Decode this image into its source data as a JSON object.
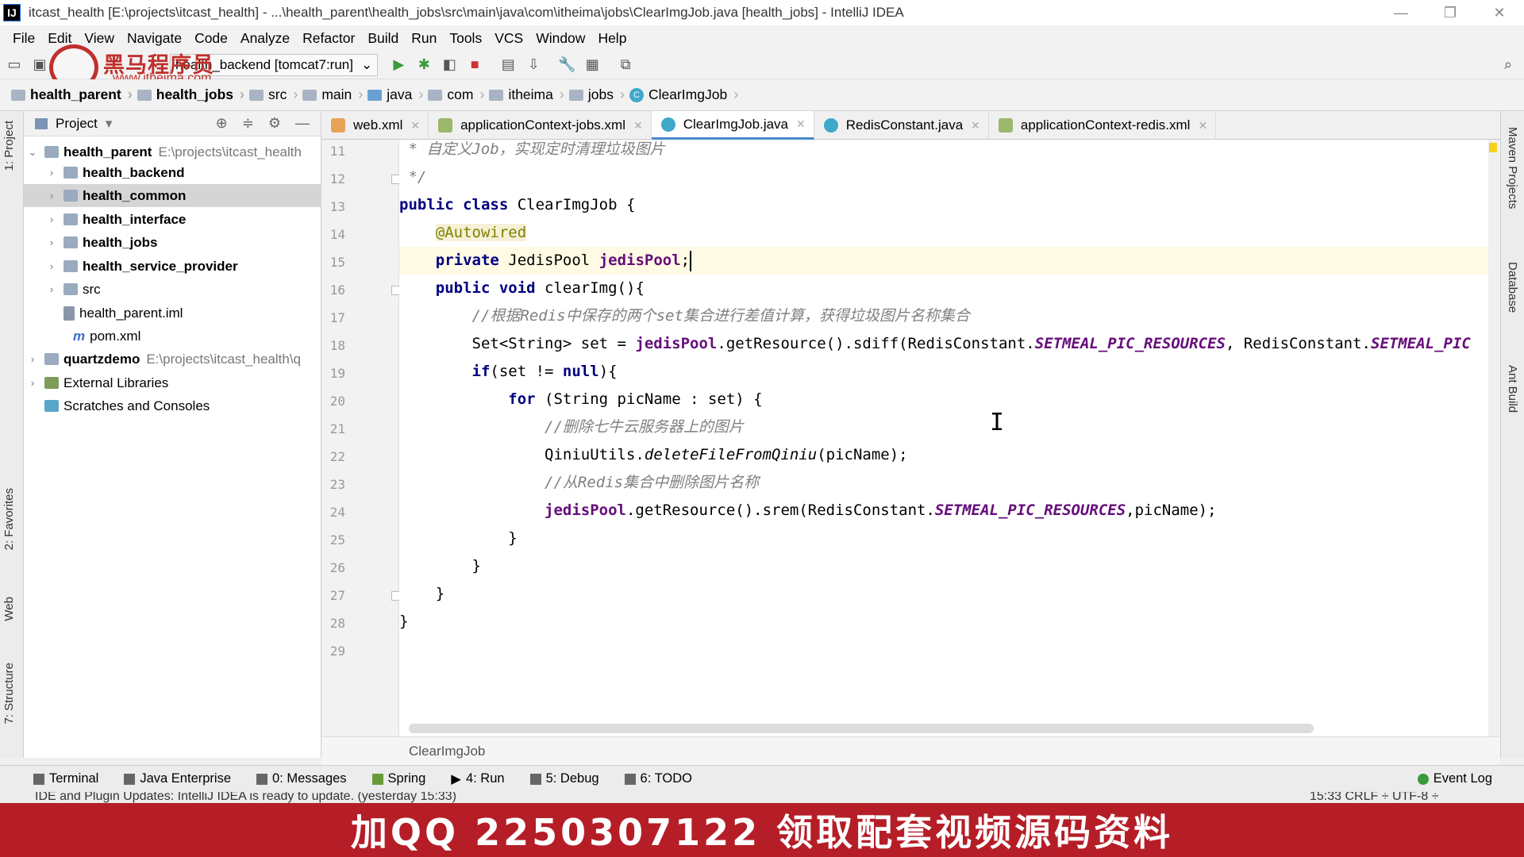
{
  "window": {
    "title": "itcast_health [E:\\projects\\itcast_health] - ...\\health_parent\\health_jobs\\src\\main\\java\\com\\itheima\\jobs\\ClearImgJob.java [health_jobs] - IntelliJ IDEA",
    "app_icon": "IJ",
    "minimize": "—",
    "restore": "❐",
    "close": "✕"
  },
  "menu": [
    "File",
    "Edit",
    "View",
    "Navigate",
    "Code",
    "Analyze",
    "Refactor",
    "Build",
    "Run",
    "Tools",
    "VCS",
    "Window",
    "Help"
  ],
  "toolbar": {
    "run_config": "health_backend [tomcat7:run]",
    "dropdown_glyph": "⌄"
  },
  "watermark": {
    "text": "黑马程序员",
    "url": "www.itheima.com"
  },
  "breadcrumb": [
    "health_parent",
    "health_jobs",
    "src",
    "main",
    "java",
    "com",
    "itheima",
    "jobs",
    "ClearImgJob"
  ],
  "left_strip": {
    "project": "1: Project",
    "favorites": "2: Favorites",
    "web": "Web",
    "structure": "7: Structure"
  },
  "right_strip": {
    "maven": "Maven Projects",
    "database": "Database",
    "ant": "Ant Build"
  },
  "project_panel": {
    "title": "Project",
    "tree": [
      {
        "label": "health_parent",
        "path": "E:\\projects\\itcast_health",
        "bold": true
      },
      {
        "label": "health_backend",
        "bold": true
      },
      {
        "label": "health_common",
        "bold": true
      },
      {
        "label": "health_interface",
        "bold": true
      },
      {
        "label": "health_jobs",
        "bold": true
      },
      {
        "label": "health_service_provider",
        "bold": true
      },
      {
        "label": "src"
      },
      {
        "label": "health_parent.iml"
      },
      {
        "label": "pom.xml"
      },
      {
        "label": "quartzdemo",
        "path": "E:\\projects\\itcast_health\\q",
        "bold": true
      },
      {
        "label": "External Libraries"
      },
      {
        "label": "Scratches and Consoles"
      }
    ]
  },
  "tabs": [
    "web.xml",
    "applicationContext-jobs.xml",
    "ClearImgJob.java",
    "RedisConstant.java",
    "applicationContext-redis.xml"
  ],
  "line_numbers": [
    "11",
    "12",
    "13",
    "14",
    "15",
    "16",
    "17",
    "18",
    "19",
    "20",
    "21",
    "22",
    "23",
    "24",
    "25",
    "26",
    "27",
    "28",
    "29"
  ],
  "code": {
    "l11": " * 自定义Job，实现定时清理垃圾图片",
    "l12": " */",
    "l13_kw": "public class",
    "l13_rest": " ClearImgJob {",
    "l14_ann": "@Autowired",
    "l15_kw": "private",
    "l15_type": " JedisPool ",
    "l15_field": "jedisPool",
    "l15_end": ";",
    "l16_kw": "public void",
    "l16_rest": " clearImg(){",
    "l17": "//根据Redis中保存的两个set集合进行差值计算，获得垃圾图片名称集合",
    "l18_a": "Set<String> set = ",
    "l18_field": "jedisPool",
    "l18_b": ".getResource().sdiff(RedisConstant.",
    "l18_const1": "SETMEAL_PIC_RESOURCES",
    "l18_c": ", RedisConstant.",
    "l18_const2": "SETMEAL_PIC",
    "l19_kw": "if",
    "l19_a": "(set != ",
    "l19_null": "null",
    "l19_b": "){",
    "l20_kw": "for",
    "l20_rest": " (String picName : set) {",
    "l21": "//删除七牛云服务器上的图片",
    "l22_a": "QiniuUtils.",
    "l22_method": "deleteFileFromQiniu",
    "l22_b": "(picName);",
    "l23": "//从Redis集合中删除图片名称",
    "l24_field": "jedisPool",
    "l24_a": ".getResource().srem(RedisConstant.",
    "l24_const": "SETMEAL_PIC_RESOURCES",
    "l24_b": ",picName);",
    "l25": "}",
    "l26": "}",
    "l27": "}",
    "l28": "}"
  },
  "editor_footer": "ClearImgJob",
  "bottom_tools": [
    "Terminal",
    "Java Enterprise",
    "0: Messages",
    "Spring",
    "4: Run",
    "5: Debug",
    "6: TODO"
  ],
  "event_log": "Event Log",
  "status": {
    "message": "IDE and Plugin Updates: IntelliJ IDEA is ready to update. (yesterday 15:33)",
    "right": "15:33   CRLF ÷   UTF-8 ÷"
  },
  "banner": "加QQ 2250307122   领取配套视频源码资料",
  "colors": {
    "keyword": "#000080",
    "comment": "#808080",
    "field": "#660e7a",
    "annotation": "#808000",
    "banner": "#b51e27"
  }
}
